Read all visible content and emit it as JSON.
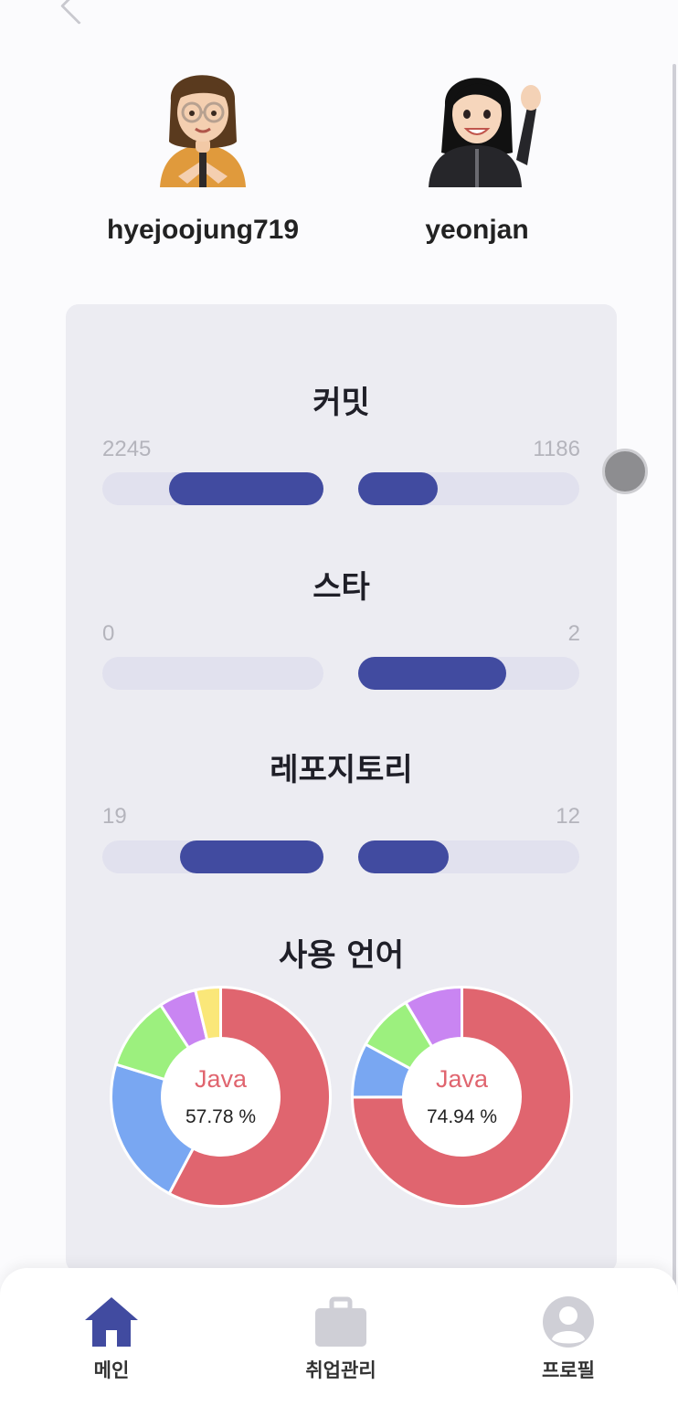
{
  "users": [
    {
      "username": "hyejoojung719"
    },
    {
      "username": "yeonjan"
    }
  ],
  "stats": {
    "commits": {
      "title": "커밋",
      "left_value": "2245",
      "right_value": "1186",
      "left_fraction": 0.7,
      "right_fraction": 0.36
    },
    "stars": {
      "title": "스타",
      "left_value": "0",
      "right_value": "2",
      "left_fraction": 0.0,
      "right_fraction": 0.67
    },
    "repositories": {
      "title": "레포지토리",
      "left_value": "19",
      "right_value": "12",
      "left_fraction": 0.65,
      "right_fraction": 0.41
    }
  },
  "languages": {
    "title": "사용 언어",
    "charts": [
      {
        "top_language": "Java",
        "top_percent": "57.78 %",
        "slices": [
          57.78,
          22.0,
          11.0,
          5.5,
          3.72
        ],
        "colors": [
          "#e0656f",
          "#79a7f2",
          "#9cf07e",
          "#c985f2",
          "#fae779"
        ]
      },
      {
        "top_language": "Java",
        "top_percent": "74.94 %",
        "slices": [
          74.94,
          8.0,
          8.5,
          8.56
        ],
        "colors": [
          "#e0656f",
          "#79a7f2",
          "#9cf07e",
          "#c985f2"
        ]
      }
    ]
  },
  "nav": {
    "main_label": "메인",
    "jobs_label": "취업관리",
    "profile_label": "프로필",
    "active_color": "#414ba0",
    "inactive_color": "#cfcfd6"
  }
}
